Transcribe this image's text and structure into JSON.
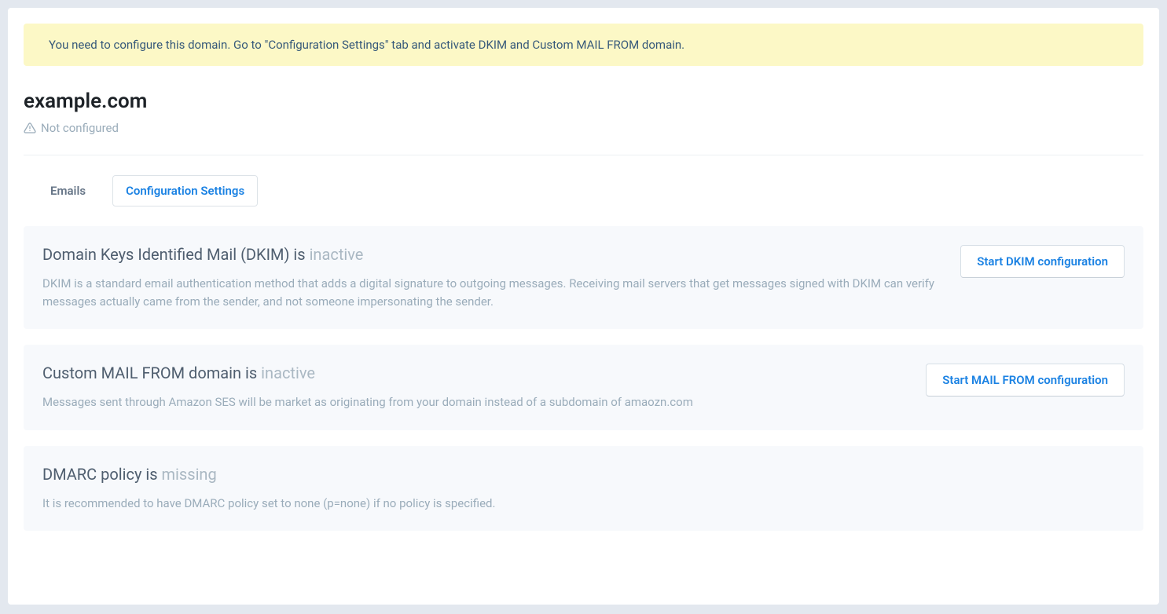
{
  "alert": {
    "message": "You need to configure this domain. Go to \"Configuration Settings\" tab and activate DKIM and Custom MAIL FROM domain."
  },
  "domain": {
    "name": "example.com",
    "status_label": "Not configured"
  },
  "tabs": {
    "emails": "Emails",
    "config": "Configuration Settings"
  },
  "panels": {
    "dkim": {
      "title_prefix": "Domain Keys Identified Mail (DKIM) is ",
      "status": "inactive",
      "desc": "DKIM is a standard email authentication method that adds a digital signature to outgoing messages. Receiving mail servers that get messages signed with DKIM can verify messages actually came from the sender, and not someone impersonating the sender.",
      "button": "Start DKIM configuration"
    },
    "mailfrom": {
      "title_prefix": "Custom MAIL FROM domain is ",
      "status": "inactive",
      "desc": "Messages sent through Amazon SES will be market as originating from your domain instead of a subdomain of amaozn.com",
      "button": "Start MAIL FROM configuration"
    },
    "dmarc": {
      "title_prefix": "DMARC policy is ",
      "status": "missing",
      "desc": "It is recommended to have DMARC policy set to none (p=none) if no policy is specified."
    }
  }
}
